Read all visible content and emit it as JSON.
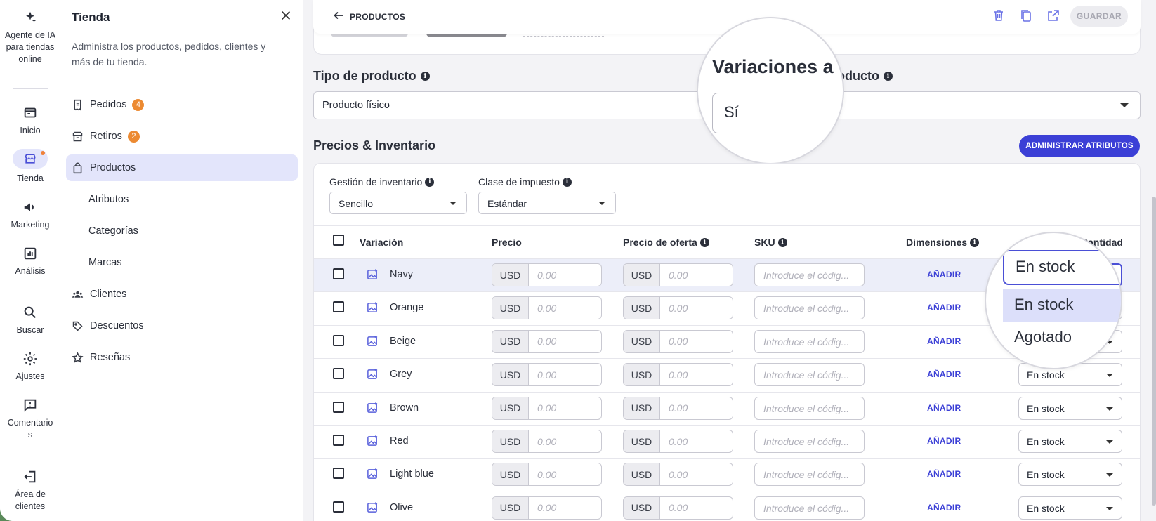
{
  "rail": {
    "items": [
      {
        "label": "Agente de IA para tiendas online",
        "icon": "sparkle-icon"
      },
      {
        "label": "Inicio",
        "icon": "home-icon"
      },
      {
        "label": "Tienda",
        "icon": "store-icon"
      },
      {
        "label": "Marketing",
        "icon": "megaphone-icon"
      },
      {
        "label": "Análisis",
        "icon": "chart-icon"
      },
      {
        "label": "Buscar",
        "icon": "search-icon"
      },
      {
        "label": "Ajustes",
        "icon": "gear-icon"
      },
      {
        "label": "Comentarios",
        "icon": "feedback-icon"
      },
      {
        "label": "Área de clientes",
        "icon": "exit-icon"
      }
    ]
  },
  "sidebar": {
    "title": "Tienda",
    "description": "Administra los productos, pedidos, clientes y más de tu tienda.",
    "items": [
      {
        "label": "Pedidos",
        "badge": "4"
      },
      {
        "label": "Retiros",
        "badge": "2"
      },
      {
        "label": "Productos"
      },
      {
        "label": "Atributos"
      },
      {
        "label": "Categorías"
      },
      {
        "label": "Marcas"
      },
      {
        "label": "Clientes"
      },
      {
        "label": "Descuentos"
      },
      {
        "label": "Reseñas"
      }
    ]
  },
  "topbar": {
    "back_label": "PRODUCTOS",
    "save_label": "GUARDAR"
  },
  "product_type": {
    "label": "Tipo de producto",
    "value": "Producto físico"
  },
  "variations": {
    "label_visible": "Variaciones a",
    "label_tail": "oducto",
    "value": "Sí"
  },
  "pricing": {
    "title": "Precios & Inventario",
    "admin_button": "ADMINISTRAR ATRIBUTOS",
    "inventory_label": "Gestión de inventario",
    "inventory_value": "Sencillo",
    "tax_label": "Clase de impuesto",
    "tax_value": "Estándar"
  },
  "table": {
    "headers": {
      "variation": "Variación",
      "price": "Precio",
      "sale_price": "Precio de oferta",
      "sku": "SKU",
      "dimensions": "Dimensiones",
      "quantity": "Cantidad"
    },
    "currency": "USD",
    "price_placeholder": "0.00",
    "sku_placeholder": "Introduce el códig...",
    "add_label": "AÑADIR",
    "stock_value": "En stock",
    "rows": [
      "Navy",
      "Orange",
      "Beige",
      "Grey",
      "Brown",
      "Red",
      "Light blue",
      "Olive"
    ]
  },
  "stock_dropdown": {
    "selected": "En stock",
    "options": [
      "En stock",
      "Agotado"
    ]
  }
}
